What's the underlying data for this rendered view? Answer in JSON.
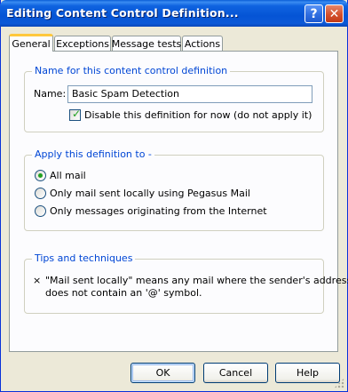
{
  "window": {
    "title": "Editing Content Control Definition...",
    "help_glyph": "?",
    "close_glyph": "✕"
  },
  "tabs": [
    {
      "label": "General",
      "active": true
    },
    {
      "label": "Exceptions",
      "active": false
    },
    {
      "label": "Message tests",
      "active": false
    },
    {
      "label": "Actions",
      "active": false
    }
  ],
  "name_group": {
    "title": "Name for this content control definition",
    "name_label": "Name:",
    "name_value": "Basic Spam Detection",
    "disable_label": "Disable this definition for now (do not apply it)",
    "disable_checked": true
  },
  "apply_group": {
    "title": "Apply this definition to -",
    "options": [
      {
        "label": "All mail",
        "selected": true
      },
      {
        "label": "Only mail sent locally using Pegasus Mail",
        "selected": false
      },
      {
        "label": "Only messages originating from the Internet",
        "selected": false
      }
    ]
  },
  "tips_group": {
    "title": "Tips and techniques",
    "bullet": "×",
    "line1": "\"Mail sent locally\" means any mail where the sender's address",
    "line2": "does not contain an '@' symbol."
  },
  "buttons": {
    "ok": "OK",
    "cancel": "Cancel",
    "help": "Help"
  },
  "colors": {
    "group_title": "#0046D5",
    "titlebar": "#0554D5",
    "dialog_bg": "#ECE9D8"
  }
}
